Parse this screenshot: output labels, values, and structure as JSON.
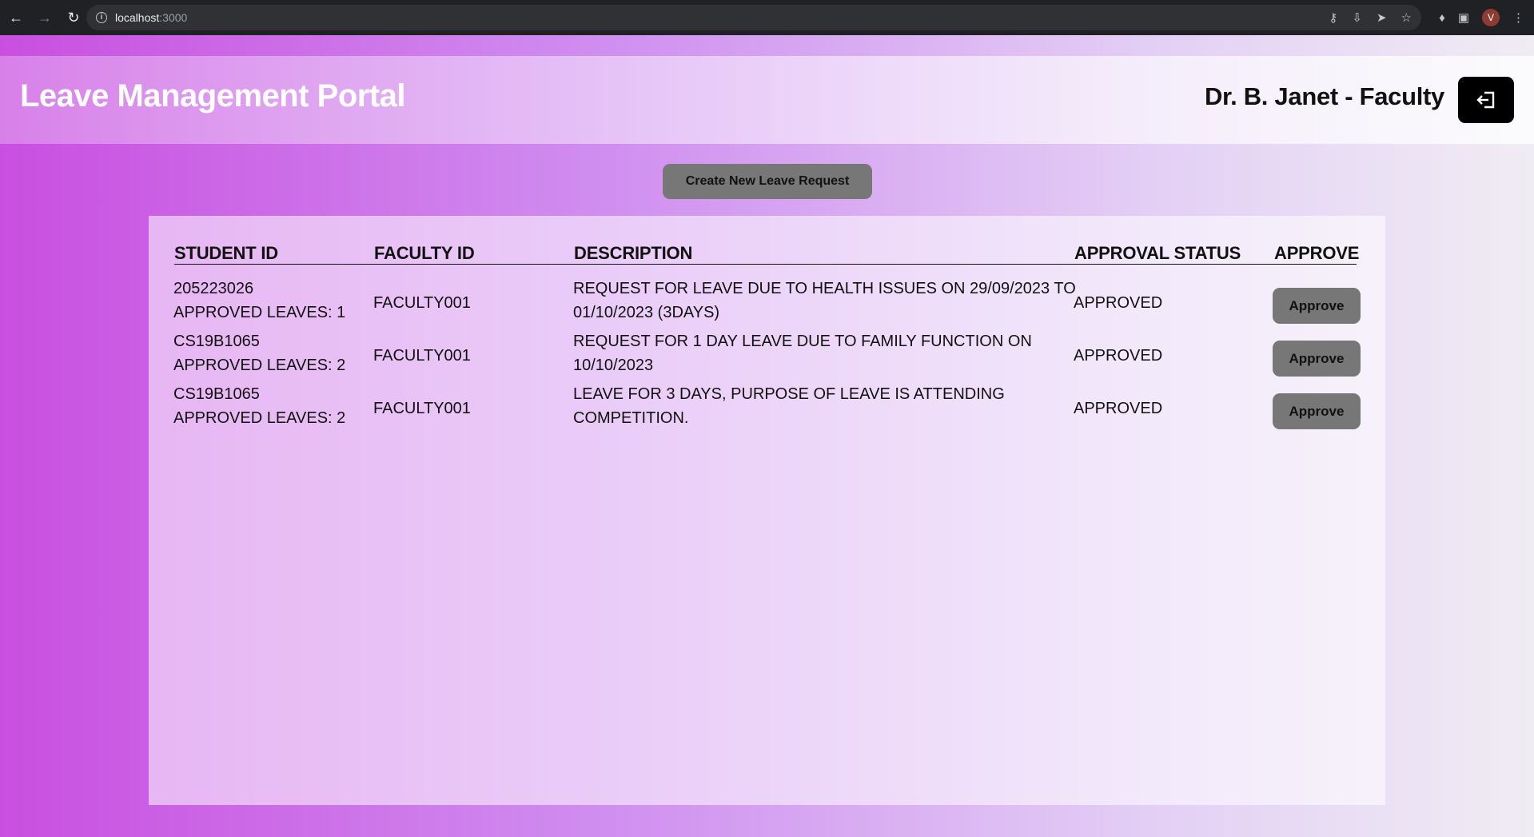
{
  "browser": {
    "url_host": "localhost",
    "url_port": ":3000",
    "profile_initial": "V"
  },
  "header": {
    "title": "Leave Management Portal",
    "user": "Dr. B. Janet - Faculty"
  },
  "actions": {
    "create_label": "Create New Leave Request"
  },
  "table": {
    "columns": [
      "STUDENT ID",
      "FACULTY ID",
      "DESCRIPTION",
      "APPROVAL STATUS",
      "APPROVE"
    ],
    "rows": [
      {
        "student_id": "205223026",
        "approved_leaves": "APPROVED LEAVES: 1",
        "faculty_id": "FACULTY001",
        "description_line1": "REQUEST FOR LEAVE DUE TO HEALTH ISSUES ON 29/09/2023 TO",
        "description_line2": "01/10/2023 (3DAYS)",
        "status": "APPROVED",
        "action": "Approve"
      },
      {
        "student_id": "CS19B1065",
        "approved_leaves": "APPROVED LEAVES: 2",
        "faculty_id": "FACULTY001",
        "description_line1": "REQUEST FOR 1 DAY LEAVE DUE TO FAMILY FUNCTION ON",
        "description_line2": "10/10/2023",
        "status": "APPROVED",
        "action": "Approve"
      },
      {
        "student_id": "CS19B1065",
        "approved_leaves": "APPROVED LEAVES: 2",
        "faculty_id": "FACULTY001",
        "description_line1": "LEAVE FOR 3 DAYS, PURPOSE OF LEAVE IS ATTENDING",
        "description_line2": "COMPETITION.",
        "status": "APPROVED",
        "action": "Approve"
      }
    ]
  }
}
